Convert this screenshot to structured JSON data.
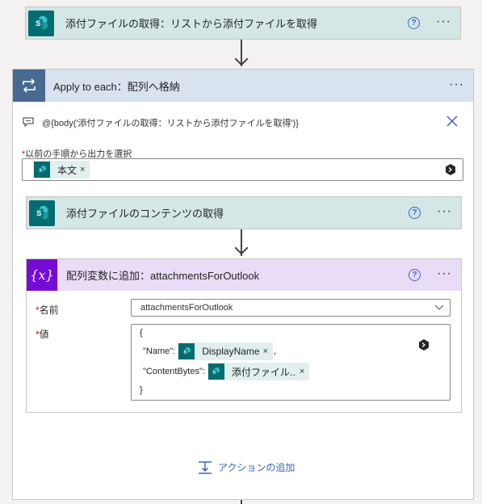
{
  "top_action": {
    "title": "添付ファイルの取得：リストから添付ファイルを取得",
    "help": "?",
    "more": "···"
  },
  "apply_each": {
    "title": "Apply to each：配列へ格納",
    "more": "···",
    "expression": "@{body('添付ファイルの取得：リストから添付ファイルを取得')}",
    "select_label": "以前の手順から出力を選択",
    "required_mark": "*",
    "token": {
      "label": "本文",
      "remove": "×"
    }
  },
  "get_content": {
    "title": "添付ファイルのコンテンツの取得",
    "help": "?",
    "more": "···"
  },
  "append_var": {
    "icon": "{x}",
    "title": "配列変数に追加：attachmentsForOutlook",
    "help": "?",
    "more": "···",
    "name_label": "名前",
    "name_value": "attachmentsForOutlook",
    "value_label": "値",
    "required_mark": "*",
    "json_open": "{",
    "key_name": "\"Name\":",
    "token_name": "DisplayName",
    "comma": ",",
    "key_content": "\"ContentBytes\":",
    "token_content": "添付ファイル...",
    "remove": "×",
    "json_close": "}"
  },
  "add_action": {
    "label": "アクションの追加"
  },
  "colors": {
    "sharepoint": "#036c70",
    "loop_header": "#d9e2ef",
    "variable": "#770bd6",
    "variable_header": "#e9dcf7",
    "sp_header": "#d4e6e6",
    "accent": "#3a63c9"
  },
  "icons": [
    "sharepoint-icon",
    "loop-icon",
    "comment-icon",
    "close-icon",
    "dynamic-content-icon",
    "variable-icon",
    "help-icon",
    "more-icon",
    "chevron-down-icon",
    "add-action-icon"
  ]
}
